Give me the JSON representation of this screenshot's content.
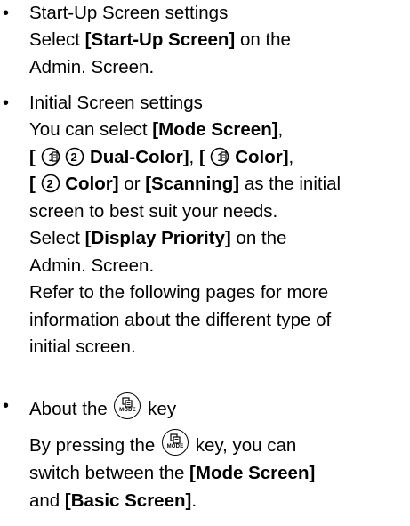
{
  "sections": [
    {
      "title": "Start-Up Screen settings",
      "select_prefix": "Select ",
      "select_item": "[Start-Up Screen]",
      "select_suffix": " on the",
      "location": "Admin. Screen."
    },
    {
      "title": "Initial Screen settings",
      "line1_prefix": "You can select ",
      "mode_screen": "[Mode Screen]",
      "comma": ",",
      "dual_open": "[ ",
      "dual_label": "Dual-Color]",
      "sep1": ", ",
      "c1_open": "[ ",
      "c1_label": "Color]",
      "sep2": ",",
      "c2_open": "[ ",
      "c2_label": "Color]",
      "or_text": " or ",
      "scanning": "[Scanning]",
      "as_initial": " as the initial",
      "line4": "screen to best suit your needs.",
      "select_prefix": "Select ",
      "display_priority": "[Display Priority]",
      "on_the": " on the",
      "location": "Admin. Screen.",
      "refer_line1": "Refer to the following pages for more",
      "refer_line2": "information about the different type of",
      "refer_line3": "initial screen."
    },
    {
      "title_prefix": "About the ",
      "title_suffix": " key",
      "line1_prefix": "By pressing the ",
      "line1_suffix": " key, you can",
      "line2_prefix": "switch between the ",
      "mode_screen": "[Mode Screen]",
      "line3_prefix": "and ",
      "basic_screen": "[Basic Screen]",
      "period": "."
    }
  ],
  "bullet_symbol": "•",
  "mode_key_label": "MODE",
  "icons": [
    "circled-1-icon",
    "circled-2-icon",
    "mode-key-icon"
  ]
}
